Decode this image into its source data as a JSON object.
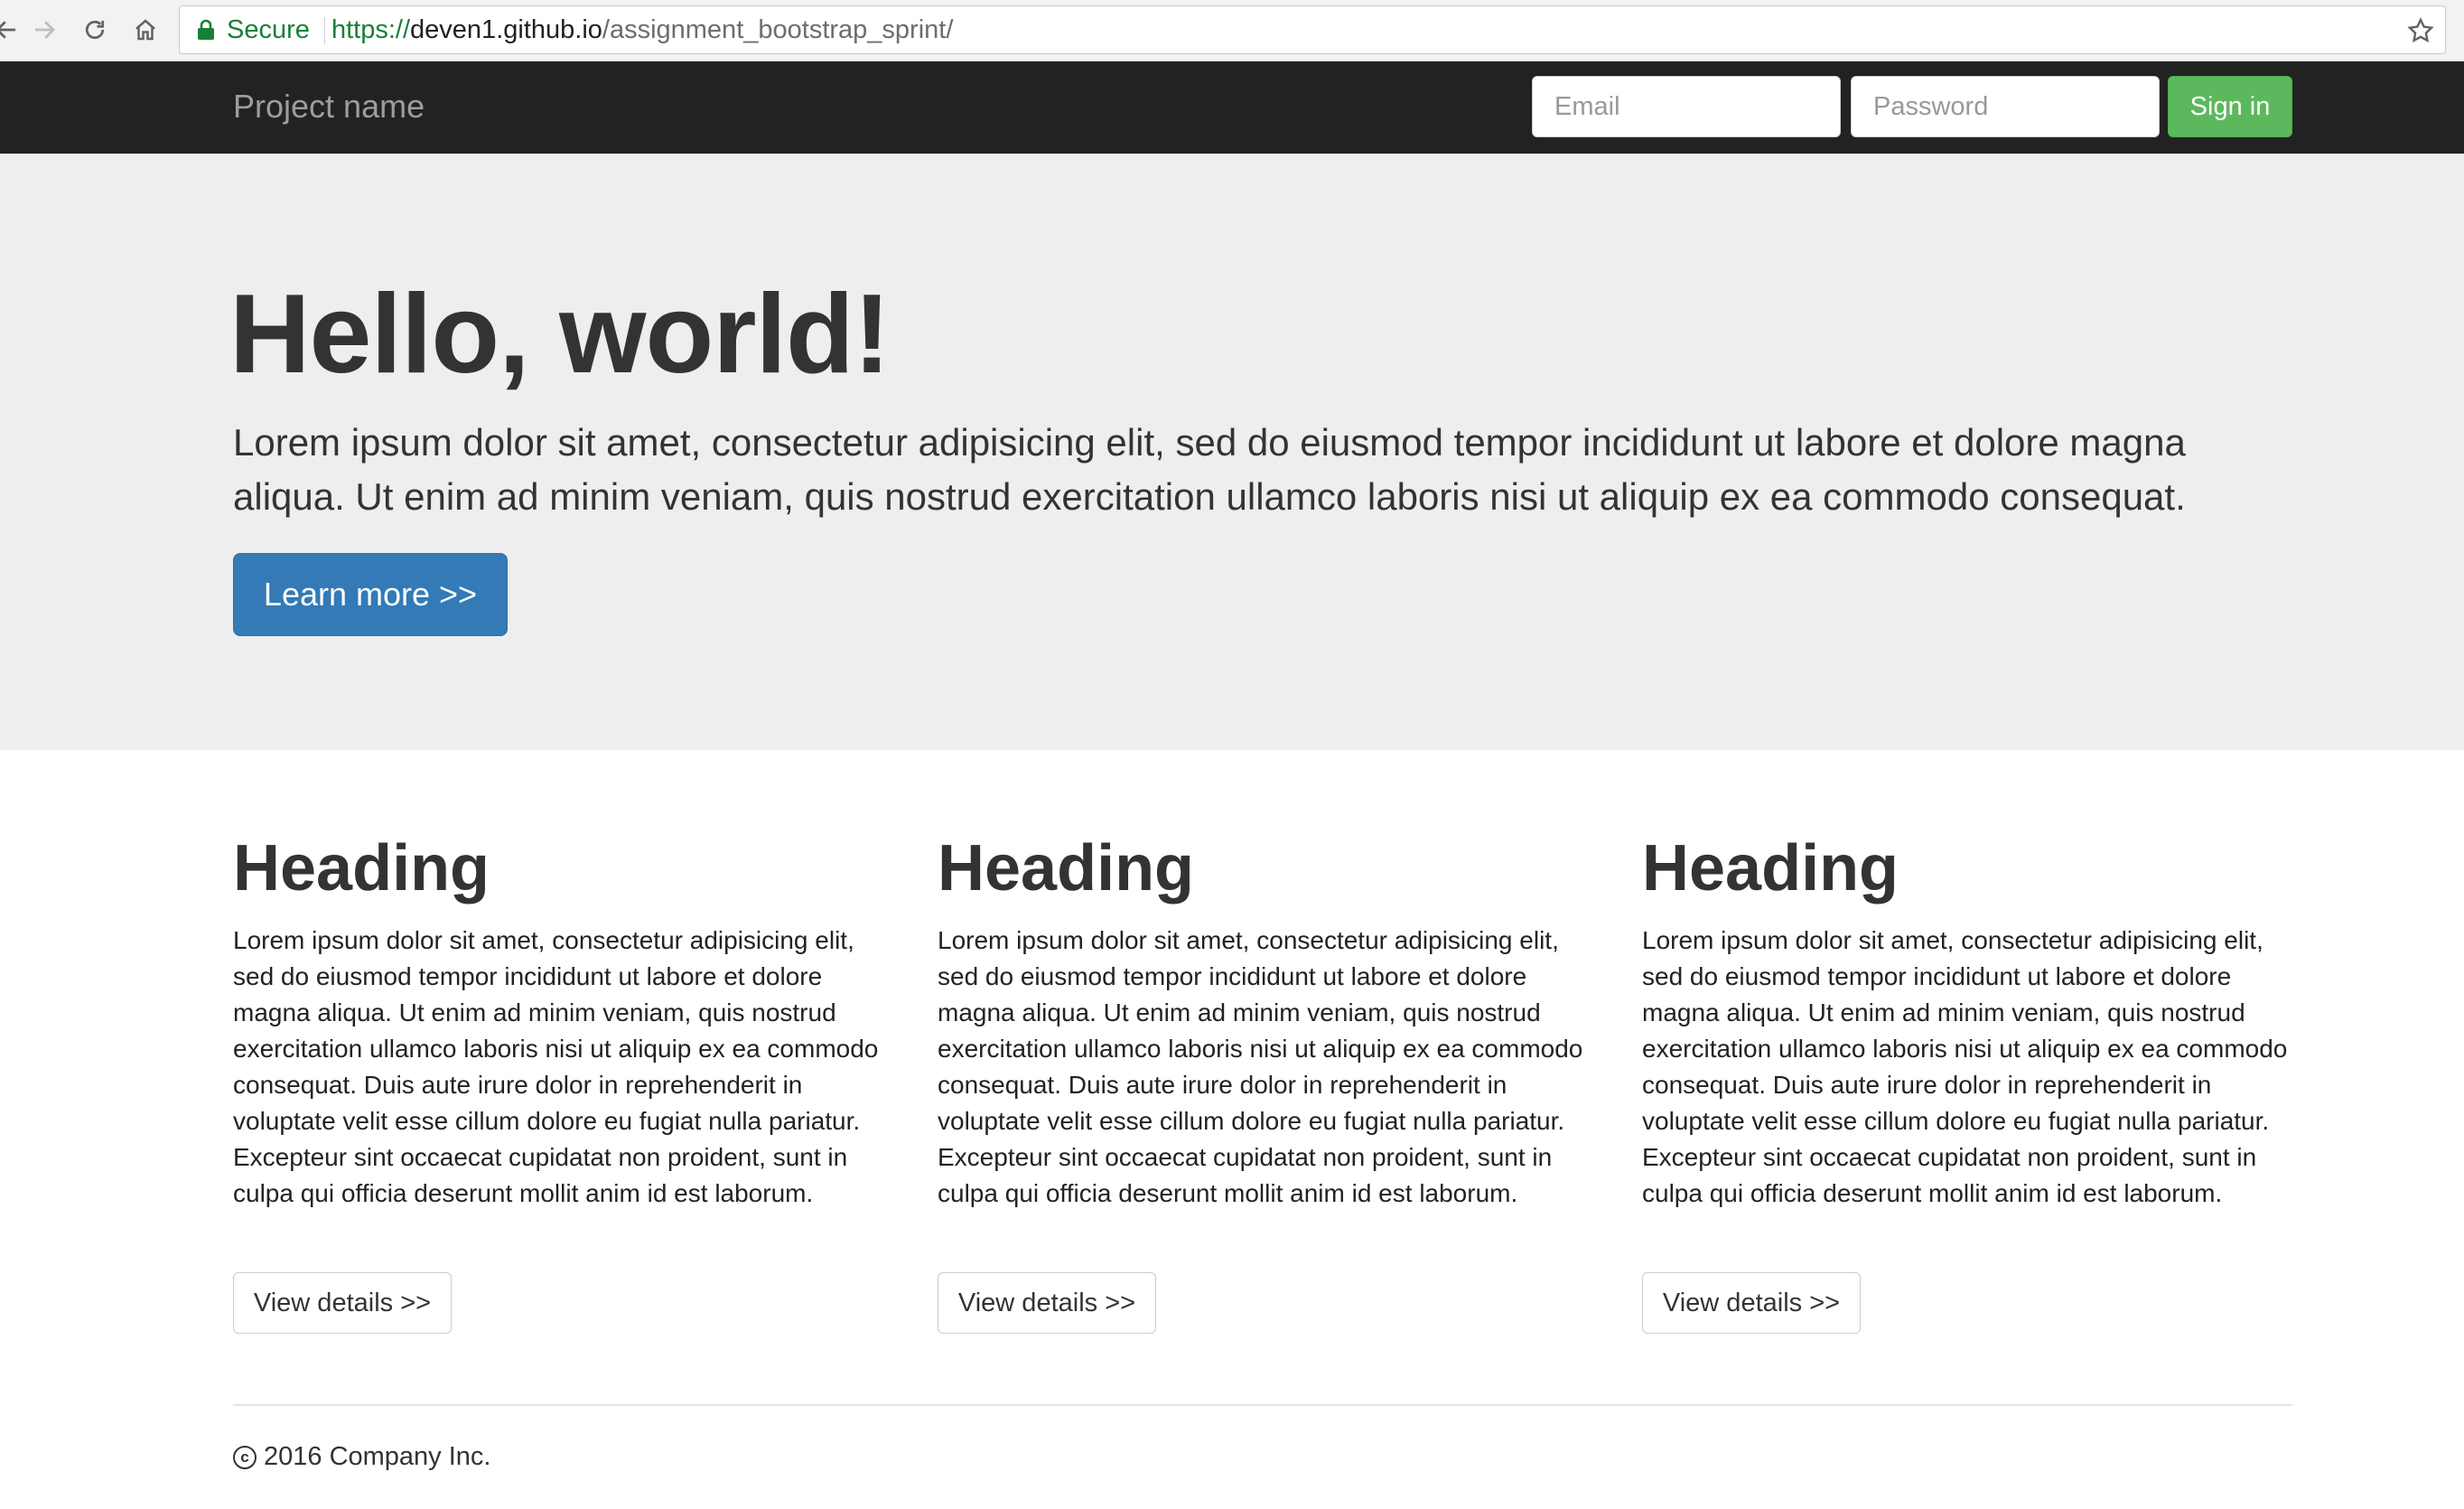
{
  "browser": {
    "secure_label": "Secure",
    "url_scheme": "https://",
    "url_host": "deven1.github.io",
    "url_path": "/assignment_bootstrap_sprint/"
  },
  "navbar": {
    "brand": "Project name",
    "email_placeholder": "Email",
    "password_placeholder": "Password",
    "signin_label": "Sign in"
  },
  "jumbotron": {
    "title": "Hello, world!",
    "text": "Lorem ipsum dolor sit amet, consectetur adipisicing elit, sed do eiusmod tempor incididunt ut labore et dolore magna aliqua. Ut enim ad minim veniam, quis nostrud exercitation ullamco laboris nisi ut aliquip ex ea commodo consequat.",
    "button_label": "Learn more >>"
  },
  "columns": [
    {
      "heading": "Heading",
      "body": "Lorem ipsum dolor sit amet, consectetur adipisicing elit, sed do eiusmod tempor incididunt ut labore et dolore magna aliqua. Ut enim ad minim veniam, quis nostrud exercitation ullamco laboris nisi ut aliquip ex ea commodo consequat. Duis aute irure dolor in reprehenderit in voluptate velit esse cillum dolore eu fugiat nulla pariatur. Excepteur sint occaecat cupidatat non proident, sunt in culpa qui officia deserunt mollit anim id est laborum.",
      "button_label": "View details >>"
    },
    {
      "heading": "Heading",
      "body": "Lorem ipsum dolor sit amet, consectetur adipisicing elit, sed do eiusmod tempor incididunt ut labore et dolore magna aliqua. Ut enim ad minim veniam, quis nostrud exercitation ullamco laboris nisi ut aliquip ex ea commodo consequat. Duis aute irure dolor in reprehenderit in voluptate velit esse cillum dolore eu fugiat nulla pariatur. Excepteur sint occaecat cupidatat non proident, sunt in culpa qui officia deserunt mollit anim id est laborum.",
      "button_label": "View details >>"
    },
    {
      "heading": "Heading",
      "body": "Lorem ipsum dolor sit amet, consectetur adipisicing elit, sed do eiusmod tempor incididunt ut labore et dolore magna aliqua. Ut enim ad minim veniam, quis nostrud exercitation ullamco laboris nisi ut aliquip ex ea commodo consequat. Duis aute irure dolor in reprehenderit in voluptate velit esse cillum dolore eu fugiat nulla pariatur. Excepteur sint occaecat cupidatat non proident, sunt in culpa qui officia deserunt mollit anim id est laborum.",
      "button_label": "View details >>"
    }
  ],
  "footer": {
    "copyright_symbol": "c",
    "text": "2016 Company Inc."
  },
  "colors": {
    "navbar_bg": "#222222",
    "jumbotron_bg": "#eeeeee",
    "primary": "#337ab7",
    "success": "#5cb85c",
    "secure_green": "#188038"
  },
  "icons": [
    "back-arrow-icon",
    "forward-arrow-icon",
    "reload-icon",
    "home-icon",
    "lock-icon",
    "bookmark-star-icon",
    "copyright-icon"
  ]
}
